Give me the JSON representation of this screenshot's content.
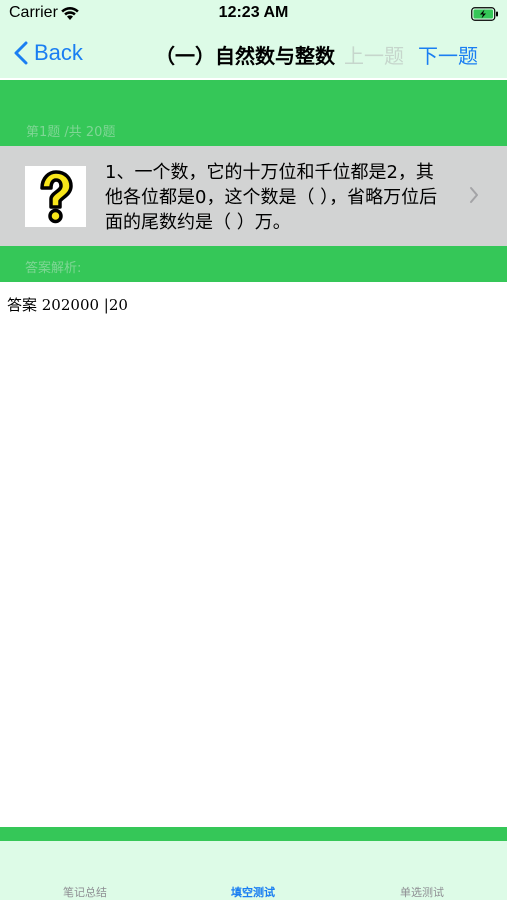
{
  "status_bar": {
    "carrier": "Carrier",
    "time": "12:23 AM",
    "icons": [
      "wifi-icon",
      "battery-charging-icon"
    ]
  },
  "nav": {
    "back_label": "Back",
    "title": "（一）自然数与整数",
    "prev_label": "上一题",
    "next_label": "下一题"
  },
  "question": {
    "counter": "第1题 /共 20题",
    "icon": "question-mark-icon",
    "text": "1、一个数，它的十万位和千位都是2，其他各位都是0，这个数是（ ），省略万位后面的尾数约是（ ）万。"
  },
  "answer": {
    "label": "答案解析:",
    "text": "答案 202000 |20"
  },
  "tabs": [
    {
      "label": "笔记总结",
      "active": false
    },
    {
      "label": "填空测试",
      "active": true
    },
    {
      "label": "单选测试",
      "active": false
    }
  ],
  "colors": {
    "accent": "#1a7ef2",
    "green": "#35c758",
    "light_green": "#ddfbe7",
    "row_gray": "#d2d3d3"
  }
}
